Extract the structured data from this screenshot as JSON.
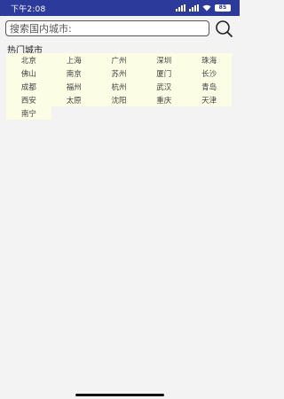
{
  "status_bar": {
    "time": "下午2:08",
    "battery": "85"
  },
  "search": {
    "placeholder": "搜索国内城市:"
  },
  "hot_cities": {
    "title": "热门城市",
    "cities": [
      "北京",
      "上海",
      "广州",
      "深圳",
      "珠海",
      "佛山",
      "南京",
      "苏州",
      "厦门",
      "长沙",
      "成都",
      "福州",
      "杭州",
      "武汉",
      "青岛",
      "西安",
      "太原",
      "沈阳",
      "重庆",
      "天津",
      "南宁"
    ]
  },
  "colors": {
    "status_bar_bg": "#2c3a9b",
    "city_cell_bg": "#fbfde4"
  }
}
